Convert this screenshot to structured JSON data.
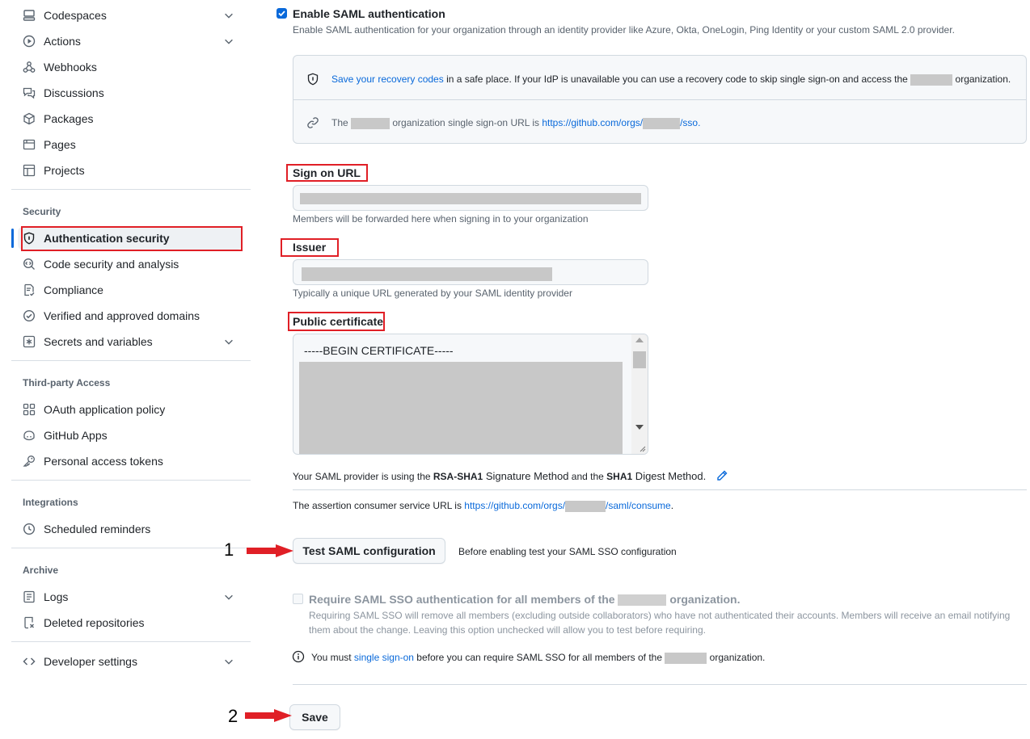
{
  "sidebar": {
    "top_items": [
      {
        "label": "Codespaces",
        "icon": "codespaces-icon",
        "has_chevron": true
      },
      {
        "label": "Actions",
        "icon": "play-icon",
        "has_chevron": true
      },
      {
        "label": "Webhooks",
        "icon": "webhook-icon",
        "has_chevron": false
      },
      {
        "label": "Discussions",
        "icon": "comment-discussion-icon",
        "has_chevron": false
      },
      {
        "label": "Packages",
        "icon": "package-icon",
        "has_chevron": false
      },
      {
        "label": "Pages",
        "icon": "browser-icon",
        "has_chevron": false
      },
      {
        "label": "Projects",
        "icon": "table-icon",
        "has_chevron": false
      }
    ],
    "security": {
      "heading": "Security",
      "items": [
        {
          "label": "Authentication security",
          "icon": "shield-lock-icon",
          "active": true
        },
        {
          "label": "Code security and analysis",
          "icon": "codescan-icon"
        },
        {
          "label": "Compliance",
          "icon": "file-check-icon"
        },
        {
          "label": "Verified and approved domains",
          "icon": "verified-icon"
        },
        {
          "label": "Secrets and variables",
          "icon": "asterisk-icon",
          "has_chevron": true
        }
      ]
    },
    "third_party": {
      "heading": "Third-party Access",
      "items": [
        {
          "label": "OAuth application policy",
          "icon": "apps-icon"
        },
        {
          "label": "GitHub Apps",
          "icon": "copilot-icon"
        },
        {
          "label": "Personal access tokens",
          "icon": "key-icon"
        }
      ]
    },
    "integrations": {
      "heading": "Integrations",
      "items": [
        {
          "label": "Scheduled reminders",
          "icon": "clock-icon"
        }
      ]
    },
    "archive": {
      "heading": "Archive",
      "items": [
        {
          "label": "Logs",
          "icon": "log-icon",
          "has_chevron": true
        },
        {
          "label": "Deleted repositories",
          "icon": "repo-deleted-icon"
        }
      ]
    },
    "developer": {
      "label": "Developer settings",
      "icon": "code-icon",
      "has_chevron": true
    }
  },
  "saml": {
    "enable_label": "Enable SAML authentication",
    "enable_checked": true,
    "enable_desc": "Enable SAML authentication for your organization through an identity provider like Azure, Okta, OneLogin, Ping Identity or your custom SAML 2.0 provider.",
    "recovery_link": "Save your recovery codes",
    "recovery_text": " in a safe place. If your IdP is unavailable you can use a recovery code to skip single sign-on and access the ",
    "recovery_text_end": " organization.",
    "sso_text_pre": "The ",
    "sso_text_mid": " organization single sign-on URL is ",
    "sso_url_pre": "https://github.com/orgs/",
    "sso_url_post": "/sso.",
    "sign_on_label": "Sign on URL",
    "sign_on_help": "Members will be forwarded here when signing in to your organization",
    "issuer_label": "Issuer",
    "issuer_help": "Typically a unique URL generated by your SAML identity provider",
    "cert_label": "Public certificate",
    "cert_first_line": "-----BEGIN CERTIFICATE-----",
    "sig_pre": "Your SAML provider is using the ",
    "sig_method": "RSA-SHA1",
    "sig_mid": " Signature Method",
    "sig_and": " and the ",
    "digest_method": "SHA1",
    "digest_post": " Digest Method.",
    "acs_pre": "The assertion consumer service URL is ",
    "acs_url_pre": "https://github.com/orgs/",
    "acs_url_post": "/saml/consume",
    "acs_end": ".",
    "test_button": "Test SAML configuration",
    "test_hint": "Before enabling test your SAML SSO configuration",
    "require_label_pre": "Require SAML SSO authentication for all members of the ",
    "require_label_post": " organization.",
    "require_desc": "Requiring SAML SSO will remove all members (excluding outside collaborators) who have not authenticated their accounts. Members will receive an email notifying them about the change. Leaving this option unchecked will allow you to test before requiring.",
    "must_pre": "You must ",
    "must_link": "single sign-on",
    "must_post": " before you can require SAML SSO for all members of the ",
    "must_end": " organization.",
    "save_button": "Save"
  },
  "annotations": {
    "step1": "1",
    "step2": "2"
  },
  "colors": {
    "accent": "#0969da",
    "highlight_border": "#e01f26",
    "arrow": "#e01f26",
    "checkbox": "#0969da"
  }
}
